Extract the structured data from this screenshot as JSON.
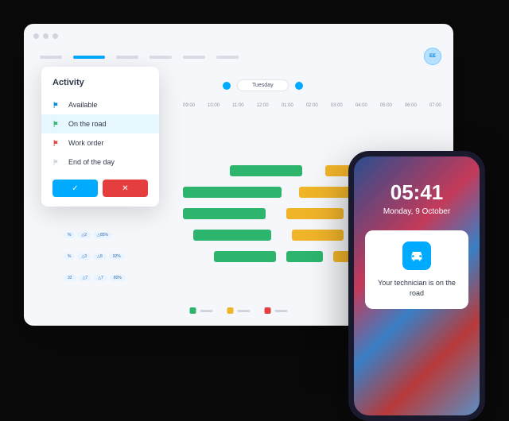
{
  "avatar": "EE",
  "day": "Tuesday",
  "times": [
    "09:00",
    "10:00",
    "11:00",
    "12:00",
    "01:00",
    "02:00",
    "03:00",
    "04:00",
    "05:00",
    "06:00",
    "07:00"
  ],
  "popup": {
    "title": "Activity",
    "items": [
      {
        "label": "Available",
        "color": "#0088dd"
      },
      {
        "label": "On the road",
        "color": "#2db56e",
        "selected": true
      },
      {
        "label": "Work order",
        "color": "#e53e3e"
      },
      {
        "label": "End of the day",
        "color": "#cbd5e0"
      }
    ]
  },
  "phone": {
    "time": "05:41",
    "date": "Monday, 9 October",
    "notif": "Your technician is on the road"
  },
  "legend_colors": [
    "#2db56e",
    "#f0b429",
    "#e53e3e"
  ]
}
